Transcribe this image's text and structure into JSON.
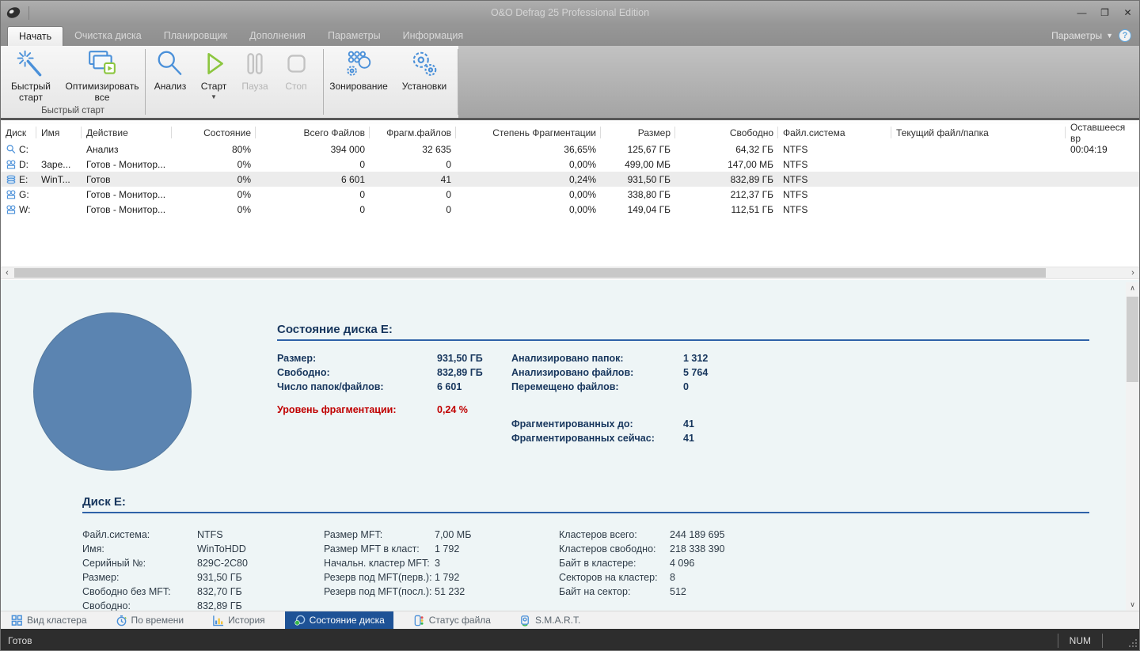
{
  "titlebar": {
    "title": "O&O Defrag 25 Professional Edition"
  },
  "menu": {
    "tabs": [
      "Начать",
      "Очистка диска",
      "Планировщик",
      "Дополнения",
      "Параметры",
      "Информация"
    ],
    "active": "Начать",
    "options_label": "Параметры"
  },
  "ribbon": {
    "group_label": "Быстрый старт",
    "buttons": [
      {
        "label": "Быстрый старт",
        "icon": "magic-wand",
        "enabled": true
      },
      {
        "label": "Оптимизировать все",
        "icon": "optimize-all",
        "enabled": true
      },
      {
        "label": "Анализ",
        "icon": "analyze",
        "enabled": true
      },
      {
        "label": "Старт",
        "icon": "start",
        "enabled": true,
        "dropdown": true
      },
      {
        "label": "Пауза",
        "icon": "pause",
        "enabled": false
      },
      {
        "label": "Стоп",
        "icon": "stop",
        "enabled": false
      },
      {
        "label": "Зонирование",
        "icon": "zoning",
        "enabled": true
      },
      {
        "label": "Установки",
        "icon": "settings",
        "enabled": true
      }
    ]
  },
  "table": {
    "columns": [
      "Диск",
      "Имя",
      "Действие",
      "Состояние",
      "Всего Файлов",
      "Фрагм.файлов",
      "Степень Фрагментации",
      "Размер",
      "Свободно",
      "Файл.система",
      "Текущий файл/папка",
      "Оставшееся вр"
    ],
    "rows": [
      {
        "icon": "drive-analyzing",
        "selected": false,
        "cells": [
          "C:",
          "",
          "Анализ",
          "80%",
          "394 000",
          "32 635",
          "36,65%",
          "125,67 ГБ",
          "64,32 ГБ",
          "NTFS",
          "",
          "00:04:19"
        ]
      },
      {
        "icon": "drive-monitored",
        "selected": false,
        "cells": [
          "D:",
          "Заре...",
          "Готов - Монитор...",
          "0%",
          "0",
          "0",
          "0,00%",
          "499,00 МБ",
          "147,00 МБ",
          "NTFS",
          "",
          ""
        ]
      },
      {
        "icon": "drive-disk",
        "selected": true,
        "cells": [
          "E:",
          "WinT...",
          "Готов",
          "0%",
          "6 601",
          "41",
          "0,24%",
          "931,50 ГБ",
          "832,89 ГБ",
          "NTFS",
          "",
          ""
        ]
      },
      {
        "icon": "drive-monitored",
        "selected": false,
        "cells": [
          "G:",
          "",
          "Готов - Монитор...",
          "0%",
          "0",
          "0",
          "0,00%",
          "338,80 ГБ",
          "212,37 ГБ",
          "NTFS",
          "",
          ""
        ]
      },
      {
        "icon": "drive-monitored",
        "selected": false,
        "cells": [
          "W:",
          "",
          "Готов - Монитор...",
          "0%",
          "0",
          "0",
          "0,00%",
          "149,04 ГБ",
          "112,51 ГБ",
          "NTFS",
          "",
          ""
        ]
      }
    ]
  },
  "disk_state": {
    "title": "Состояние диска E:",
    "left": [
      {
        "label": "Размер:",
        "value": "931,50 ГБ"
      },
      {
        "label": "Свободно:",
        "value": "832,89 ГБ"
      },
      {
        "label": "Число папок/файлов:",
        "value": "6 601"
      }
    ],
    "fragmentation": {
      "label": "Уровень фрагментации:",
      "value": "0,24 %"
    },
    "right": [
      {
        "label": "Анализировано папок:",
        "value": "1 312"
      },
      {
        "label": "Анализировано файлов:",
        "value": "5 764"
      },
      {
        "label": "Перемещено файлов:",
        "value": "0"
      }
    ],
    "right2": [
      {
        "label": "Фрагментированных до:",
        "value": "41"
      },
      {
        "label": "Фрагментированных сейчас:",
        "value": "41"
      }
    ]
  },
  "disk_info": {
    "title": "Диск E:",
    "col1": [
      {
        "label": "Файл.система:",
        "value": "NTFS"
      },
      {
        "label": "Имя:",
        "value": "WinToHDD"
      },
      {
        "label": "Серийный №:",
        "value": "829C-2C80"
      },
      {
        "label": "Размер:",
        "value": "931,50 ГБ"
      },
      {
        "label": "Свободно без MFT:",
        "value": "832,70 ГБ"
      },
      {
        "label": "Свободно:",
        "value": "832,89 ГБ"
      }
    ],
    "col2": [
      {
        "label": "Размер MFT:",
        "value": "7,00 МБ"
      },
      {
        "label": "Размер MFT в класт:",
        "value": "1 792"
      },
      {
        "label": "Начальн. кластер MFT:",
        "value": "3"
      },
      {
        "label": "Резерв под MFT(перв.):",
        "value": "1 792"
      },
      {
        "label": "Резерв под MFT(посл.):",
        "value": "51 232"
      }
    ],
    "col3": [
      {
        "label": "Кластеров всего:",
        "value": "244 189 695"
      },
      {
        "label": "Кластеров свободно:",
        "value": "218 338 390"
      },
      {
        "label": "Байт в кластере:",
        "value": "4 096"
      },
      {
        "label": "Секторов на кластер:",
        "value": "8"
      },
      {
        "label": "Байт на сектор:",
        "value": "512"
      }
    ]
  },
  "bottom_tabs": [
    {
      "label": "Вид кластера",
      "icon": "cluster-view",
      "active": false
    },
    {
      "label": "По времени",
      "icon": "time",
      "active": false
    },
    {
      "label": "История",
      "icon": "history",
      "active": false
    },
    {
      "label": "Состояние диска",
      "icon": "disk-state-pie",
      "active": true
    },
    {
      "label": "Статус файла",
      "icon": "file-status",
      "active": false
    },
    {
      "label": "S.M.A.R.T.",
      "icon": "smart",
      "active": false
    }
  ],
  "statusbar": {
    "ready": "Готов",
    "num": "NUM"
  },
  "colors": {
    "accent_blue": "#1e5296",
    "pie_blue": "#5b84b1",
    "alert_red": "#c00000",
    "heading_navy": "#17365d",
    "icon_blue": "#4a90d9",
    "icon_green": "#8cc63f"
  }
}
